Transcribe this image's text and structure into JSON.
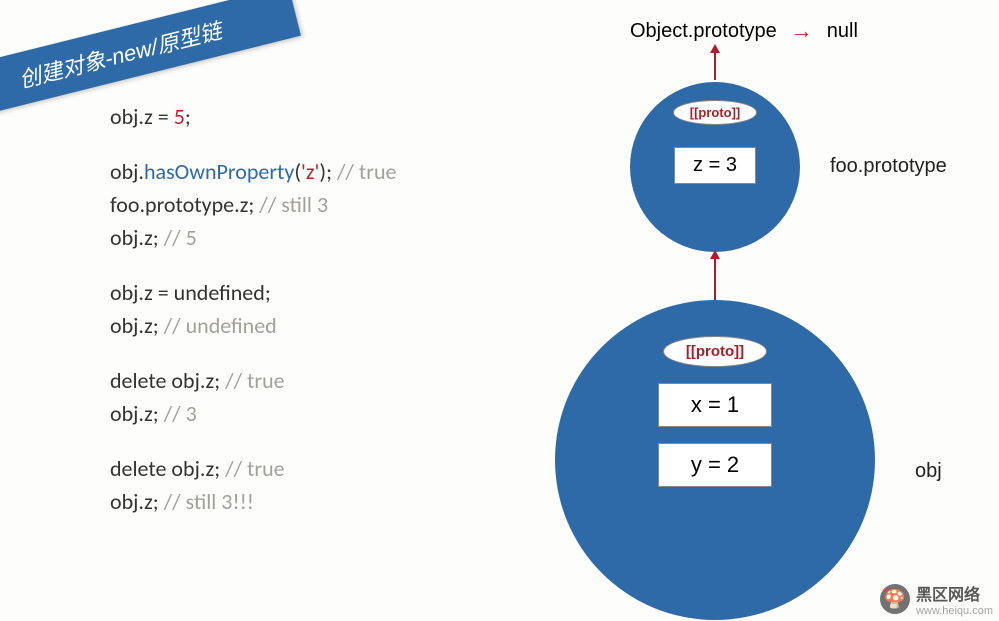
{
  "banner": "创建对象-new/原型链",
  "code": {
    "p1": {
      "l1_pre": "obj.z = ",
      "l1_num": "5",
      "l1_post": ";"
    },
    "p2": {
      "l1_pre": "obj.",
      "l1_method": "hasOwnProperty",
      "l1_paren_open": "(",
      "l1_str": "'z'",
      "l1_paren_close": "); ",
      "l1_comment": "// true",
      "l2": "foo.prototype.z; ",
      "l2_comment": "// still 3",
      "l3": "obj.z; ",
      "l3_comment": "// 5"
    },
    "p3": {
      "l1": "obj.z = undefined;",
      "l2": "obj.z; ",
      "l2_comment": "// undefined"
    },
    "p4": {
      "l1": "delete obj.z; ",
      "l1_comment": "// true",
      "l2": "obj.z; ",
      "l2_comment": "// 3"
    },
    "p5": {
      "l1": "delete obj.z; ",
      "l1_comment": "// true",
      "l2": "obj.z; ",
      "l2_comment": "// still 3!!!"
    }
  },
  "diagram": {
    "top_left": "Object.prototype",
    "top_right": "null",
    "proto_label": "[[proto]]",
    "small_circle": {
      "value": "z = 3",
      "label": "foo.prototype"
    },
    "big_circle": {
      "value1": "x = 1",
      "value2": "y = 2",
      "label": "obj"
    }
  },
  "watermark": {
    "title": "黑区网络",
    "sub": "www.heiqu.com"
  },
  "chart_data": {
    "type": "diagram",
    "description": "JavaScript prototype chain illustration",
    "chain": [
      "obj",
      "foo.prototype",
      "Object.prototype",
      "null"
    ],
    "objects": {
      "obj": {
        "own_properties": {
          "x": 1,
          "y": 2
        },
        "proto": "foo.prototype"
      },
      "foo.prototype": {
        "own_properties": {
          "z": 3
        },
        "proto": "Object.prototype"
      },
      "Object.prototype": {
        "proto": "null"
      }
    }
  }
}
